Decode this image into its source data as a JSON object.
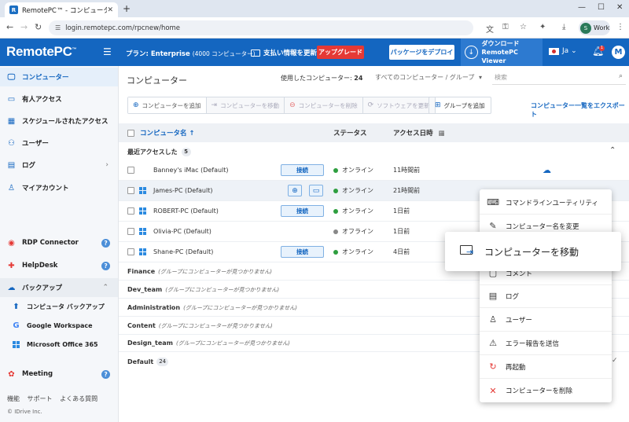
{
  "browser": {
    "tab_title": "RemotePC™ - コンピューター",
    "url": "login.remotepc.com/rpcnew/home",
    "profile_initial": "S",
    "profile_label": "Work"
  },
  "header": {
    "logo": "RemotePC",
    "plan_label": "プラン: Enterprise",
    "plan_detail": "(4000 コンピューター)",
    "billing_label": "支払い情報を更新",
    "upgrade_label": "アップグレード",
    "deploy_label": "パッケージをデプロイ",
    "download_line1": "ダウンロード",
    "download_line2": "RemotePC Viewer",
    "lang": "Ja",
    "notif_count": "1",
    "user_initial": "M"
  },
  "sidebar": {
    "items": [
      {
        "label": "コンピューター",
        "icon": "monitor-icon"
      },
      {
        "label": "有人アクセス",
        "icon": "attended-icon"
      },
      {
        "label": "スケジュールされたアクセス",
        "icon": "calendar-icon"
      },
      {
        "label": "ユーザー",
        "icon": "users-icon"
      },
      {
        "label": "ログ",
        "icon": "log-icon"
      },
      {
        "label": "マイアカウント",
        "icon": "account-icon"
      },
      {
        "label": "RDP Connector",
        "icon": "rdp-icon"
      },
      {
        "label": "HelpDesk",
        "icon": "helpdesk-icon"
      },
      {
        "label": "バックアップ",
        "icon": "backup-icon"
      },
      {
        "label": "コンピュータ バックアップ",
        "icon": "computer-backup-icon"
      },
      {
        "label": "Google Workspace",
        "icon": "google-icon"
      },
      {
        "label": "Microsoft Office 365",
        "icon": "office-icon"
      },
      {
        "label": "Meeting",
        "icon": "meeting-icon"
      }
    ],
    "footer": [
      "機能",
      "サポート",
      "よくある質問"
    ],
    "copyright": "© IDrive Inc."
  },
  "main": {
    "title": "コンピューター",
    "used_label": "使用したコンピューター: ",
    "used_count": "24",
    "filter_label": "すべてのコンピューター / グループ",
    "search_placeholder": "検索",
    "toolbar": {
      "add": "コンピューターを追加",
      "move": "コンピューターを移動",
      "delete": "コンピューターを削除",
      "update": "ソフトウェアを更新",
      "add_group": "グループを追加",
      "export": "コンピューター一覧をエクスポート"
    },
    "columns": {
      "name": "コンピュータ名 ↑",
      "status": "ステータス",
      "access": "アクセス日時"
    },
    "recent_label": "最近アクセスした",
    "recent_count": "5",
    "connect_label": "接続",
    "rows": [
      {
        "name": "Banney's iMac (Default)",
        "os": "mac",
        "status": "オンライン",
        "online": true,
        "access": "11時間前"
      },
      {
        "name": "James-PC (Default)",
        "os": "windows",
        "status": "オンライン",
        "online": true,
        "access": "21時間前"
      },
      {
        "name": "ROBERT-PC (Default)",
        "os": "windows",
        "status": "オンライン",
        "online": true,
        "access": "1日前"
      },
      {
        "name": "Olivia-PC (Default)",
        "os": "windows",
        "status": "オフライン",
        "online": false,
        "access": "1日前"
      },
      {
        "name": "Shane-PC (Default)",
        "os": "windows",
        "status": "オンライン",
        "online": true,
        "access": "4日前"
      }
    ],
    "empty_note": "(グループにコンピューターが見つかりません)",
    "groups": [
      {
        "name": "Finance"
      },
      {
        "name": "Dev_team"
      },
      {
        "name": "Administration"
      },
      {
        "name": "Content"
      },
      {
        "name": "Design_team"
      },
      {
        "name": "Default",
        "count": "24"
      }
    ]
  },
  "context_menu": {
    "items": [
      {
        "label": "コマンドラインユーティリティ",
        "icon": "terminal-icon"
      },
      {
        "label": "コンピューター名を変更",
        "icon": "rename-icon"
      },
      {
        "label": "コメント",
        "icon": "comment-icon"
      },
      {
        "label": "ログ",
        "icon": "log-icon"
      },
      {
        "label": "ユーザー",
        "icon": "user-icon"
      },
      {
        "label": "エラー報告を送信",
        "icon": "warning-icon"
      },
      {
        "label": "再起動",
        "icon": "restart-icon"
      },
      {
        "label": "コンピューターを削除",
        "icon": "delete-icon"
      }
    ],
    "highlight": "コンピューターを移動"
  }
}
